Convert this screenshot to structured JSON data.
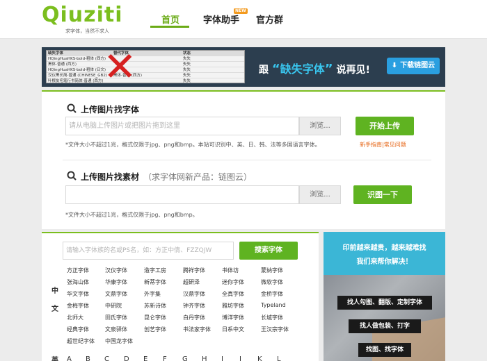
{
  "header": {
    "logo_word": "Qiuziti",
    "logo_tagline": "求字体，当然不求人",
    "nav": [
      {
        "label": "首页",
        "active": true
      },
      {
        "label": "字体助手",
        "badge": "NEW"
      },
      {
        "label": "官方群"
      }
    ]
  },
  "banner": {
    "table": {
      "headers": [
        "缺失字体",
        "替代字体",
        "状态"
      ],
      "rows": [
        [
          "HQingHuaHKS-bold-粗体 (西方)",
          "",
          "失失"
        ],
        [
          "黑体-普通 (西方)",
          "",
          "失失"
        ],
        [
          "HQingHuaHKS-bold-粗体 (日文)",
          "",
          "失失"
        ],
        [
          "汉仪黑长简-普通 (CHINESE_GB2)",
          "黑体-普通 (西方)",
          "失失"
        ],
        [
          "叶根友毛笔行书简体-普通 (西方)",
          "",
          "失失"
        ]
      ]
    },
    "text_prefix": "跟",
    "text_highlight": "缺失字体",
    "text_suffix": "说再见!",
    "download_label": "下载链图云"
  },
  "upload_font": {
    "title": "上传图片找字体",
    "placeholder": "请从电脑上传图片或把图片拖到这里",
    "browse_label": "浏览...",
    "submit_label": "开始上传",
    "note": "*文件大小不超过1兆，格式仅限于jpg、png和bmp。本站可识别中、英、日、韩、法等多国语言字体。",
    "help_links": "新手指南|常见问题"
  },
  "upload_material": {
    "title": "上传图片找素材",
    "subtitle": "（求字体网新产品：链图云）",
    "browse_label": "浏览...",
    "submit_label": "识图一下",
    "note": "*文件大小不超过1兆，格式仅限于jpg、png和bmp。"
  },
  "font_search": {
    "placeholder": "请输入字体族的名或PS名，如：方正中倩、FZZQJW",
    "button_label": "搜索字体",
    "chinese_label_1": "中",
    "chinese_label_2": "文",
    "english_label": "英",
    "fonts": [
      [
        "方正字体",
        "汉仪字体",
        "造字工房",
        "腾祥字体",
        "书体坊",
        "蒙纳字体"
      ],
      [
        "张海山体",
        "华康字体",
        "新蒂字体",
        "超研泽",
        "迷你字体",
        "微软字体"
      ],
      [
        "华文字体",
        "文鼎字体",
        "外字集",
        "汉鼎字体",
        "全真字体",
        "金桥字体"
      ],
      [
        "金梅字体",
        "中研院",
        "苏新诗体",
        "钟齐字体",
        "雅坊字体",
        "Typeland"
      ],
      [
        "北师大",
        "田氏字体",
        "昆仑字体",
        "白丹字体",
        "博洋字体",
        "长城字体"
      ],
      [
        "经典字体",
        "文泉驿体",
        "创艺字体",
        "书法家字体",
        "日系中文",
        "王汉宗字体"
      ],
      [
        "超世纪字体",
        "中国龙字体"
      ]
    ],
    "letters": [
      "A",
      "B",
      "C",
      "D",
      "E",
      "F",
      "G",
      "H",
      "I",
      "J",
      "K",
      "L"
    ]
  },
  "ad": {
    "line1": "印前越来越贵，越来越难找",
    "line2": "我们来帮你解决！",
    "tags": [
      "找人勾图、翻版、定制字体",
      "找人做包装、打字",
      "找图、找字体"
    ]
  }
}
